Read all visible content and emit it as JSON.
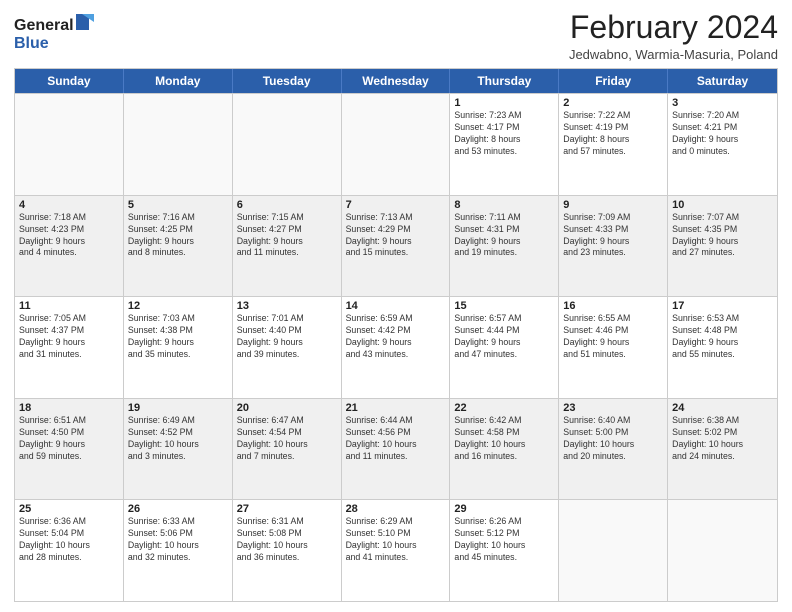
{
  "header": {
    "logo_general": "General",
    "logo_blue": "Blue",
    "month_title": "February 2024",
    "location": "Jedwabno, Warmia-Masuria, Poland"
  },
  "days_of_week": [
    "Sunday",
    "Monday",
    "Tuesday",
    "Wednesday",
    "Thursday",
    "Friday",
    "Saturday"
  ],
  "weeks": [
    {
      "alt": false,
      "cells": [
        {
          "day": "",
          "info": ""
        },
        {
          "day": "",
          "info": ""
        },
        {
          "day": "",
          "info": ""
        },
        {
          "day": "",
          "info": ""
        },
        {
          "day": "1",
          "info": "Sunrise: 7:23 AM\nSunset: 4:17 PM\nDaylight: 8 hours\nand 53 minutes."
        },
        {
          "day": "2",
          "info": "Sunrise: 7:22 AM\nSunset: 4:19 PM\nDaylight: 8 hours\nand 57 minutes."
        },
        {
          "day": "3",
          "info": "Sunrise: 7:20 AM\nSunset: 4:21 PM\nDaylight: 9 hours\nand 0 minutes."
        }
      ]
    },
    {
      "alt": true,
      "cells": [
        {
          "day": "4",
          "info": "Sunrise: 7:18 AM\nSunset: 4:23 PM\nDaylight: 9 hours\nand 4 minutes."
        },
        {
          "day": "5",
          "info": "Sunrise: 7:16 AM\nSunset: 4:25 PM\nDaylight: 9 hours\nand 8 minutes."
        },
        {
          "day": "6",
          "info": "Sunrise: 7:15 AM\nSunset: 4:27 PM\nDaylight: 9 hours\nand 11 minutes."
        },
        {
          "day": "7",
          "info": "Sunrise: 7:13 AM\nSunset: 4:29 PM\nDaylight: 9 hours\nand 15 minutes."
        },
        {
          "day": "8",
          "info": "Sunrise: 7:11 AM\nSunset: 4:31 PM\nDaylight: 9 hours\nand 19 minutes."
        },
        {
          "day": "9",
          "info": "Sunrise: 7:09 AM\nSunset: 4:33 PM\nDaylight: 9 hours\nand 23 minutes."
        },
        {
          "day": "10",
          "info": "Sunrise: 7:07 AM\nSunset: 4:35 PM\nDaylight: 9 hours\nand 27 minutes."
        }
      ]
    },
    {
      "alt": false,
      "cells": [
        {
          "day": "11",
          "info": "Sunrise: 7:05 AM\nSunset: 4:37 PM\nDaylight: 9 hours\nand 31 minutes."
        },
        {
          "day": "12",
          "info": "Sunrise: 7:03 AM\nSunset: 4:38 PM\nDaylight: 9 hours\nand 35 minutes."
        },
        {
          "day": "13",
          "info": "Sunrise: 7:01 AM\nSunset: 4:40 PM\nDaylight: 9 hours\nand 39 minutes."
        },
        {
          "day": "14",
          "info": "Sunrise: 6:59 AM\nSunset: 4:42 PM\nDaylight: 9 hours\nand 43 minutes."
        },
        {
          "day": "15",
          "info": "Sunrise: 6:57 AM\nSunset: 4:44 PM\nDaylight: 9 hours\nand 47 minutes."
        },
        {
          "day": "16",
          "info": "Sunrise: 6:55 AM\nSunset: 4:46 PM\nDaylight: 9 hours\nand 51 minutes."
        },
        {
          "day": "17",
          "info": "Sunrise: 6:53 AM\nSunset: 4:48 PM\nDaylight: 9 hours\nand 55 minutes."
        }
      ]
    },
    {
      "alt": true,
      "cells": [
        {
          "day": "18",
          "info": "Sunrise: 6:51 AM\nSunset: 4:50 PM\nDaylight: 9 hours\nand 59 minutes."
        },
        {
          "day": "19",
          "info": "Sunrise: 6:49 AM\nSunset: 4:52 PM\nDaylight: 10 hours\nand 3 minutes."
        },
        {
          "day": "20",
          "info": "Sunrise: 6:47 AM\nSunset: 4:54 PM\nDaylight: 10 hours\nand 7 minutes."
        },
        {
          "day": "21",
          "info": "Sunrise: 6:44 AM\nSunset: 4:56 PM\nDaylight: 10 hours\nand 11 minutes."
        },
        {
          "day": "22",
          "info": "Sunrise: 6:42 AM\nSunset: 4:58 PM\nDaylight: 10 hours\nand 16 minutes."
        },
        {
          "day": "23",
          "info": "Sunrise: 6:40 AM\nSunset: 5:00 PM\nDaylight: 10 hours\nand 20 minutes."
        },
        {
          "day": "24",
          "info": "Sunrise: 6:38 AM\nSunset: 5:02 PM\nDaylight: 10 hours\nand 24 minutes."
        }
      ]
    },
    {
      "alt": false,
      "cells": [
        {
          "day": "25",
          "info": "Sunrise: 6:36 AM\nSunset: 5:04 PM\nDaylight: 10 hours\nand 28 minutes."
        },
        {
          "day": "26",
          "info": "Sunrise: 6:33 AM\nSunset: 5:06 PM\nDaylight: 10 hours\nand 32 minutes."
        },
        {
          "day": "27",
          "info": "Sunrise: 6:31 AM\nSunset: 5:08 PM\nDaylight: 10 hours\nand 36 minutes."
        },
        {
          "day": "28",
          "info": "Sunrise: 6:29 AM\nSunset: 5:10 PM\nDaylight: 10 hours\nand 41 minutes."
        },
        {
          "day": "29",
          "info": "Sunrise: 6:26 AM\nSunset: 5:12 PM\nDaylight: 10 hours\nand 45 minutes."
        },
        {
          "day": "",
          "info": ""
        },
        {
          "day": "",
          "info": ""
        }
      ]
    }
  ]
}
